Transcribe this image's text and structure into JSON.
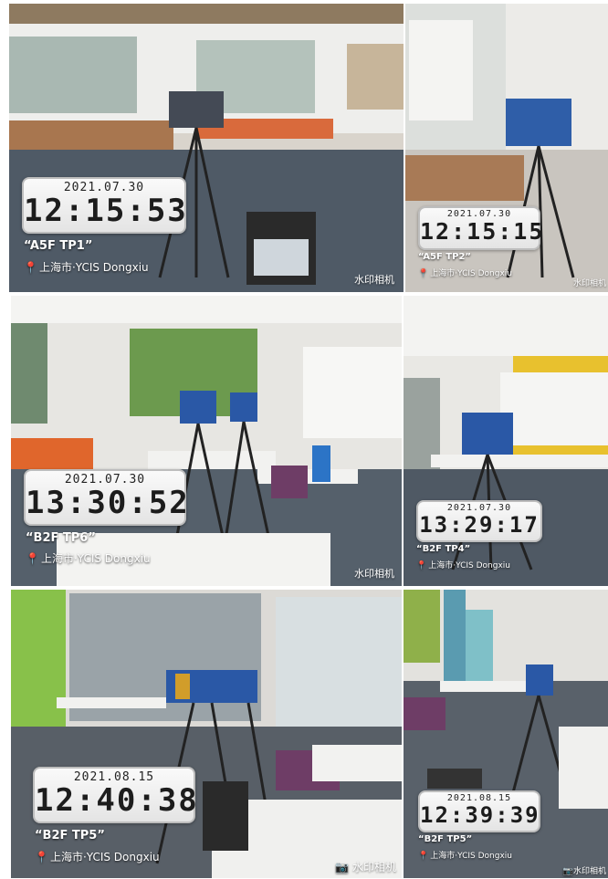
{
  "photos": [
    {
      "id": "p1",
      "date": "2021.07.30",
      "time": "12:15:53",
      "label": "A5F TP1",
      "location": "上海市·YCIS Dongxiu",
      "watermark": "水印相机"
    },
    {
      "id": "p2",
      "date": "2021.07.30",
      "time": "12:15:15",
      "label": "A5F TP2",
      "location": "上海市·YCIS Dongxiu",
      "watermark": "水印相机"
    },
    {
      "id": "p3",
      "date": "2021.07.30",
      "time": "13:30:52",
      "label": "B2F TP6",
      "location": "上海市·YCIS Dongxiu",
      "watermark": "水印相机"
    },
    {
      "id": "p4",
      "date": "2021.07.30",
      "time": "13:29:17",
      "label": "B2F TP4",
      "location": "上海市·YCIS Dongxiu",
      "watermark": ""
    },
    {
      "id": "p5",
      "date": "2021.08.15",
      "time": "12:40:38",
      "label": "B2F TP5",
      "location": "上海市·YCIS Dongxiu",
      "watermark": "水印相机"
    },
    {
      "id": "p6",
      "date": "2021.08.15",
      "time": "12:39:39",
      "label": "B2F TP5",
      "location": "上海市·YCIS Dongxiu",
      "watermark": "水印相机"
    }
  ]
}
